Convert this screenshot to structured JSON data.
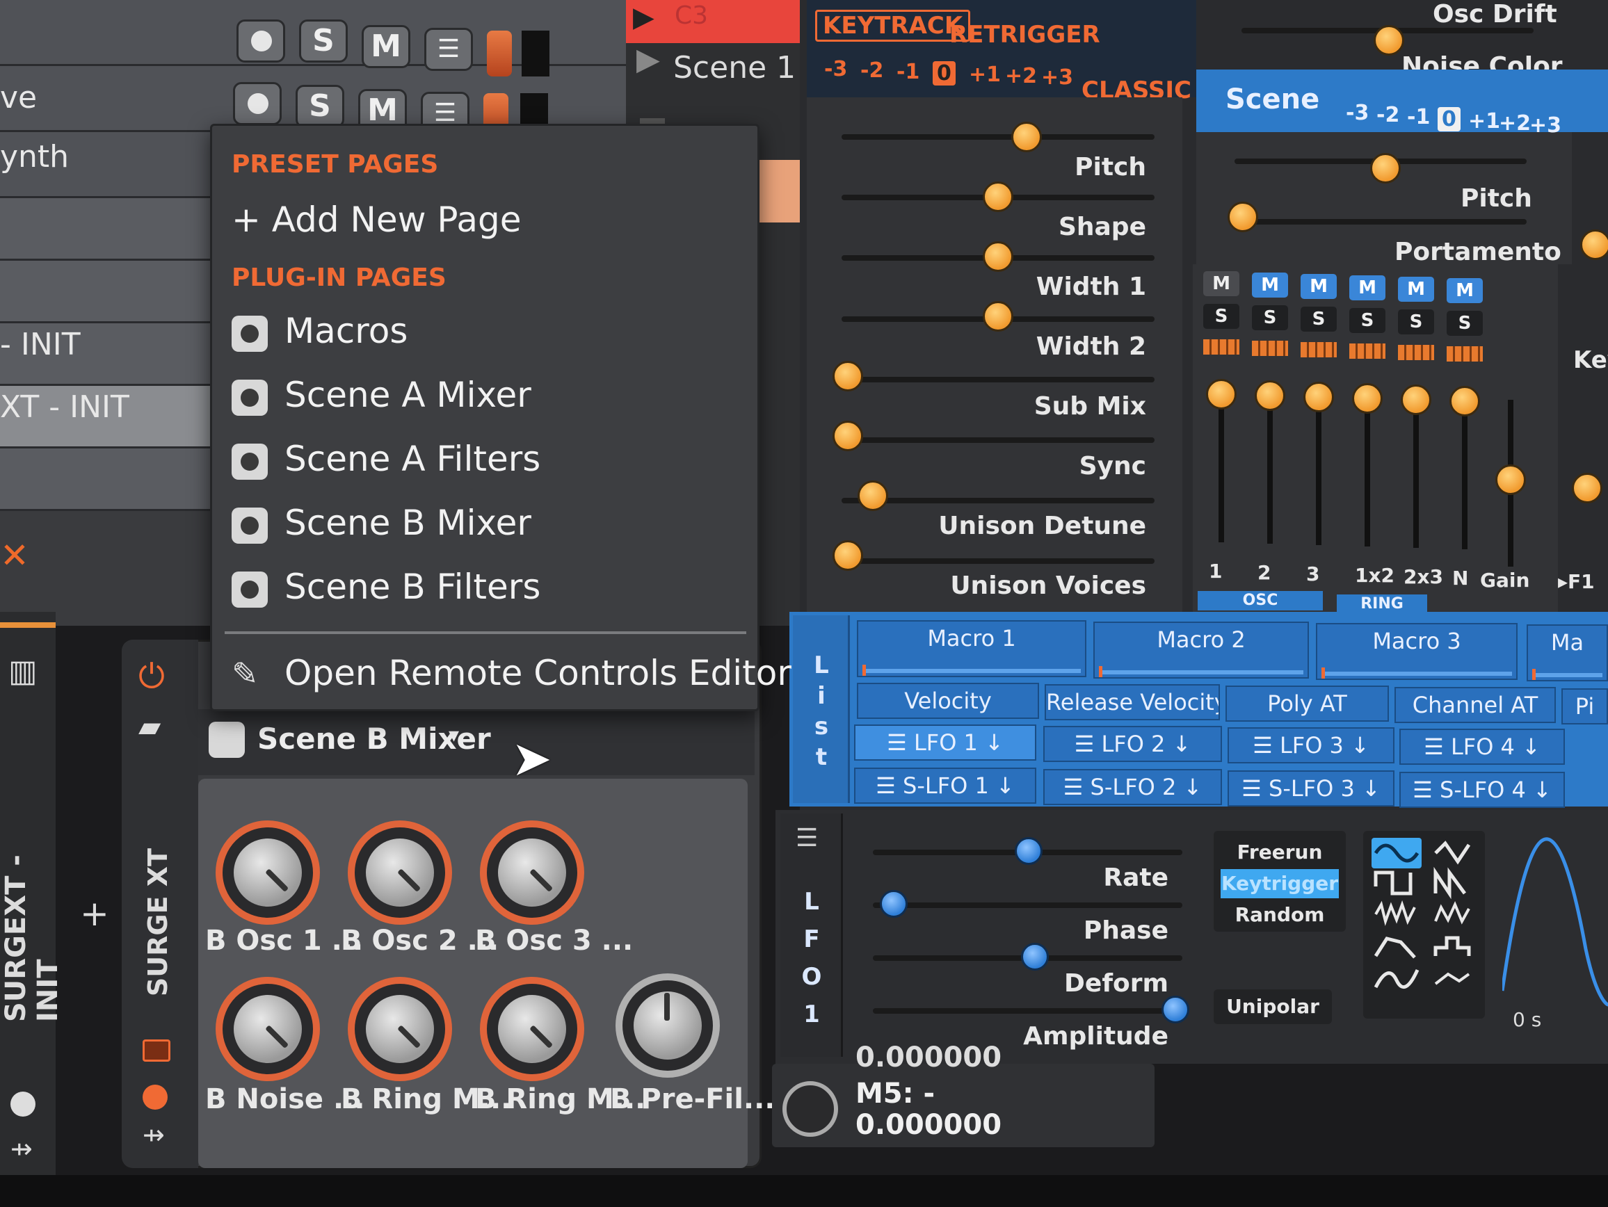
{
  "tracks": {
    "scene_label": "Scene 1",
    "clip_red_label": "C3",
    "rows": [
      {
        "name": "ve"
      },
      {
        "name": "ynth"
      },
      {
        "name": "- INIT"
      },
      {
        "name": "XT - INIT"
      }
    ],
    "solo_label": "S",
    "mute_label": "M",
    "close_glyph": "✕"
  },
  "menu": {
    "preset_pages_header": "PRESET PAGES",
    "add_new_page": "+ Add New Page",
    "plugin_pages_header": "PLUG-IN PAGES",
    "items": [
      {
        "label": "Macros"
      },
      {
        "label": "Scene A Mixer"
      },
      {
        "label": "Scene A Filters"
      },
      {
        "label": "Scene B Mixer"
      },
      {
        "label": "Scene B Filters"
      }
    ],
    "open_editor": "Open Remote Controls Editor"
  },
  "device": {
    "vertical_name": "SURGEXT - INIT",
    "plugin_name": "SURGE XT",
    "page_selector": "Scene B Mixer",
    "add_glyph": "+",
    "knobs": [
      {
        "label": "B Osc 1 ..."
      },
      {
        "label": "B Osc 2 ..."
      },
      {
        "label": "B Osc 3 ..."
      },
      {
        "label": "B Noise ..."
      },
      {
        "label": "B Ring M..."
      },
      {
        "label": "B Ring M..."
      },
      {
        "label": "B Pre-Fil..."
      }
    ]
  },
  "surge": {
    "keytrack": "KEYTRACK",
    "retrigger": "RETRIGGER",
    "octaves": [
      "-3",
      "-2",
      "-1",
      "0",
      "+1",
      "+2",
      "+3"
    ],
    "classic": "CLASSIC ▾",
    "osc_params": [
      {
        "label": "Pitch",
        "value": 0.59
      },
      {
        "label": "Shape",
        "value": 0.5
      },
      {
        "label": "Width 1",
        "value": 0.5
      },
      {
        "label": "Width 2",
        "value": 0.5
      },
      {
        "label": "Sub Mix",
        "value": 0.02
      },
      {
        "label": "Sync",
        "value": 0.02
      },
      {
        "label": "Unison Detune",
        "value": 0.1
      },
      {
        "label": "Unison Voices",
        "value": 0.02
      }
    ],
    "top_right": {
      "osc_drift": "Osc Drift",
      "noise_color": "Noise Color"
    },
    "scene_title": "Scene",
    "scene_octaves": [
      "-3",
      "-2",
      "-1",
      "0",
      "+1",
      "+2",
      "+3"
    ],
    "scene_params": [
      {
        "label": "Pitch",
        "value": 0.5
      },
      {
        "label": "Portamento",
        "value": 0.0
      }
    ],
    "mixer": {
      "mute": "M",
      "solo": "S",
      "channels": [
        "1",
        "2",
        "3",
        "1x2",
        "2x3",
        "N",
        "Gain"
      ],
      "osc_group": "OSC",
      "ring_group": "RING",
      "extra_label": "Key",
      "f1_label": "▸F1"
    },
    "routing": {
      "list_tab": "List",
      "macros": [
        "Macro 1",
        "Macro 2",
        "Macro 3",
        "Ma"
      ],
      "row2": [
        "Velocity",
        "Release Velocity",
        "Poly AT",
        "Channel AT",
        "Pi"
      ],
      "row3": [
        "LFO 1",
        "LFO 2",
        "LFO 3",
        "LFO 4"
      ],
      "row4": [
        "S-LFO 1",
        "S-LFO 2",
        "S-LFO 3",
        "S-LFO 4"
      ]
    },
    "lfo": {
      "tab": "LFO 1",
      "params": [
        {
          "label": "Rate",
          "value": 0.48
        },
        {
          "label": "Phase",
          "value": 0.0
        },
        {
          "label": "Deform",
          "value": 0.5
        },
        {
          "label": "Amplitude",
          "value": 1.0
        }
      ],
      "modes": [
        "Freerun",
        "Keytrigger",
        "Random"
      ],
      "unipolar": "Unipolar",
      "time_label": "0 s"
    },
    "footer": {
      "m5_label": "M5: -",
      "m5_value": "0.000000",
      "top_value": "0.000000"
    }
  },
  "colors": {
    "accent_orange": "#f06a34",
    "surge_blue": "#2d7ac8",
    "clip_red": "#e8453c"
  }
}
